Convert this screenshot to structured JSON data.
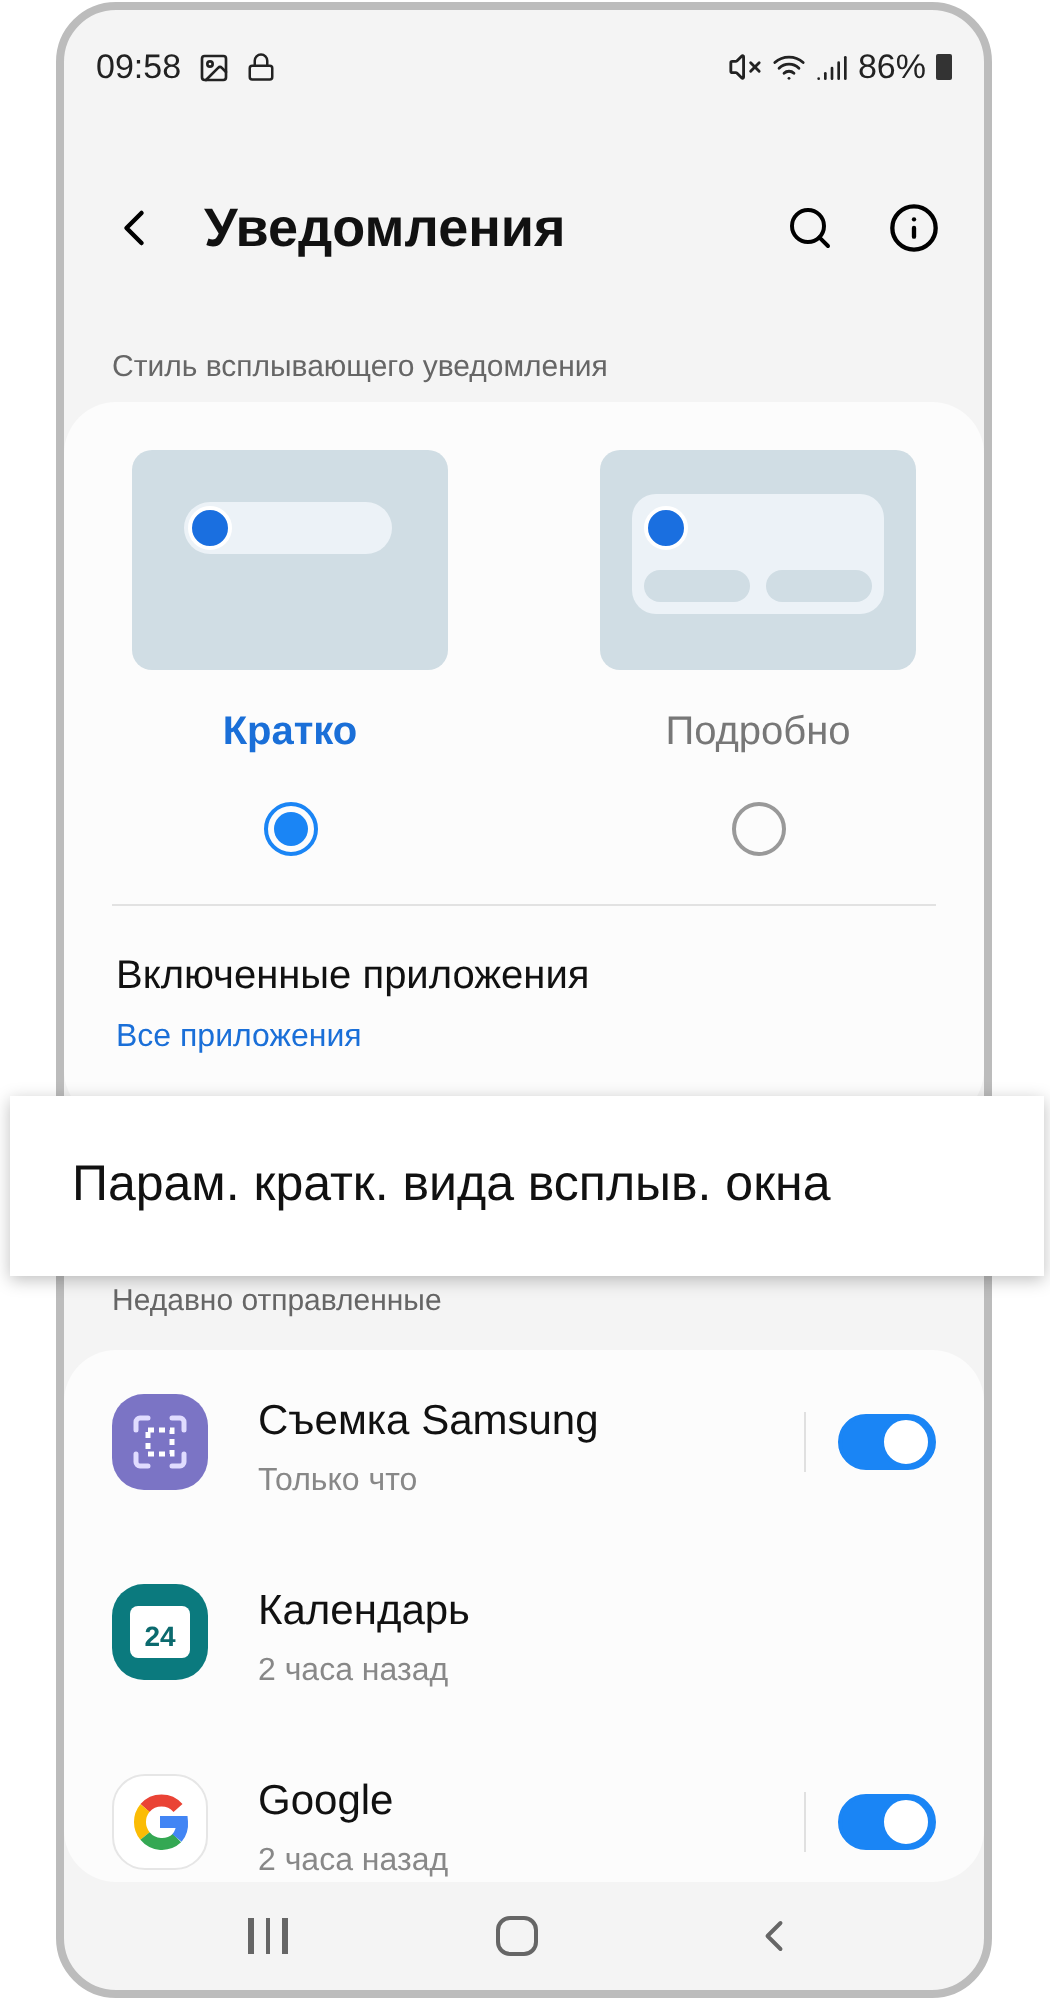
{
  "status_bar": {
    "time": "09:58",
    "battery": "86%"
  },
  "header": {
    "title": "Уведомления"
  },
  "popup_style": {
    "label": "Стиль всплывающего уведомления",
    "options": [
      {
        "kind": "brief",
        "label": "Кратко",
        "selected": true
      },
      {
        "kind": "detailed",
        "label": "Подробно",
        "selected": false
      }
    ]
  },
  "enabled_apps": {
    "title": "Включенные приложения",
    "link": "Все приложения"
  },
  "callout": {
    "text": "Парам. кратк. вида всплыв. окна"
  },
  "recent": {
    "label": "Недавно отправленные",
    "apps": [
      {
        "kind": "camera",
        "name": "Съемка Samsung",
        "time": "Только что",
        "on": true
      },
      {
        "kind": "calendar",
        "name": "Календарь",
        "time": "2 часа назад",
        "icon_text": "24"
      },
      {
        "kind": "google",
        "name": "Google",
        "time": "2 часа назад",
        "on": true
      }
    ]
  }
}
